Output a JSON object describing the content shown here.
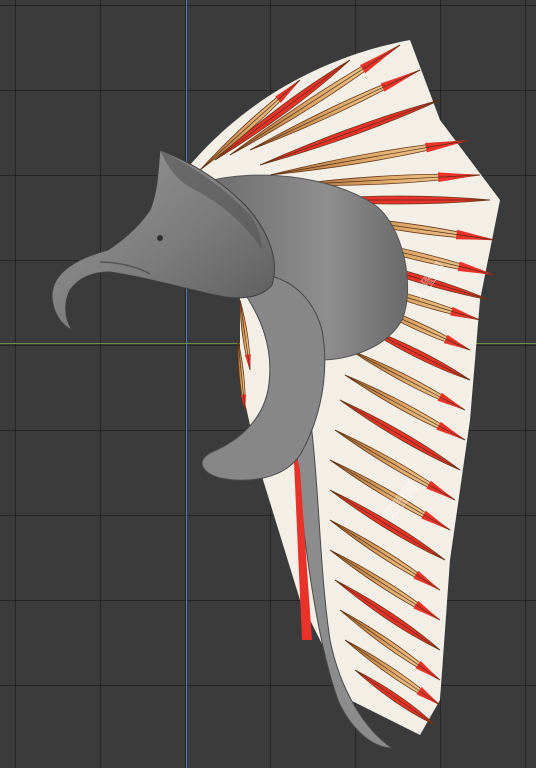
{
  "viewport": {
    "grid_color": "#141414",
    "background_color": "#3b3b3b",
    "axis_x_color": "#6f8f3a",
    "axis_y_color": "#4f79b8"
  },
  "model": {
    "description_icon": "eagle-headdress-model",
    "feather_colors": [
      "#d9a56a",
      "#e8322a",
      "#a86a3a",
      "#f2e2c8"
    ],
    "head_color": "#7a7a7a"
  },
  "watermark": {
    "text_top": "汇图网",
    "text_bottom": "汇图网"
  }
}
